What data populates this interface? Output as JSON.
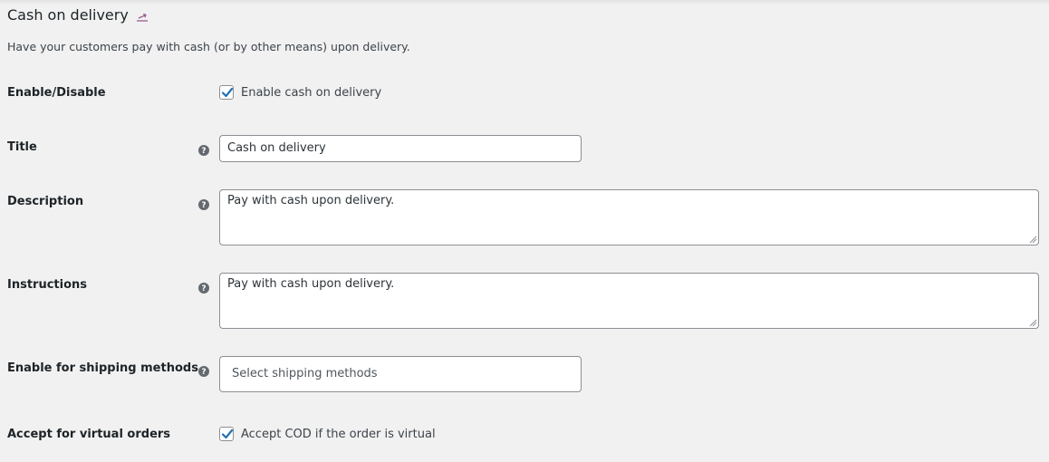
{
  "header": {
    "title": "Cash on delivery",
    "return_icon": "return-arrow-icon",
    "description": "Have your customers pay with cash (or by other means) upon delivery."
  },
  "fields": {
    "enable": {
      "label": "Enable/Disable",
      "checkbox_label": "Enable cash on delivery",
      "checked": true
    },
    "title": {
      "label": "Title",
      "value": "Cash on delivery"
    },
    "description": {
      "label": "Description",
      "value": "Pay with cash upon delivery."
    },
    "instructions": {
      "label": "Instructions",
      "value": "Pay with cash upon delivery."
    },
    "shipping_methods": {
      "label": "Enable for shipping methods",
      "placeholder": "Select shipping methods"
    },
    "virtual_orders": {
      "label": "Accept for virtual orders",
      "checkbox_label": "Accept COD if the order is virtual",
      "checked": true
    }
  },
  "icons": {
    "help": "help-tip-icon",
    "check": "checkmark-icon"
  },
  "colors": {
    "background": "#f1f1f1",
    "link_accent": "#9b5c8f",
    "checkmark": "#2271b1",
    "help_icon": "#646970",
    "input_border": "#8c8f94"
  }
}
